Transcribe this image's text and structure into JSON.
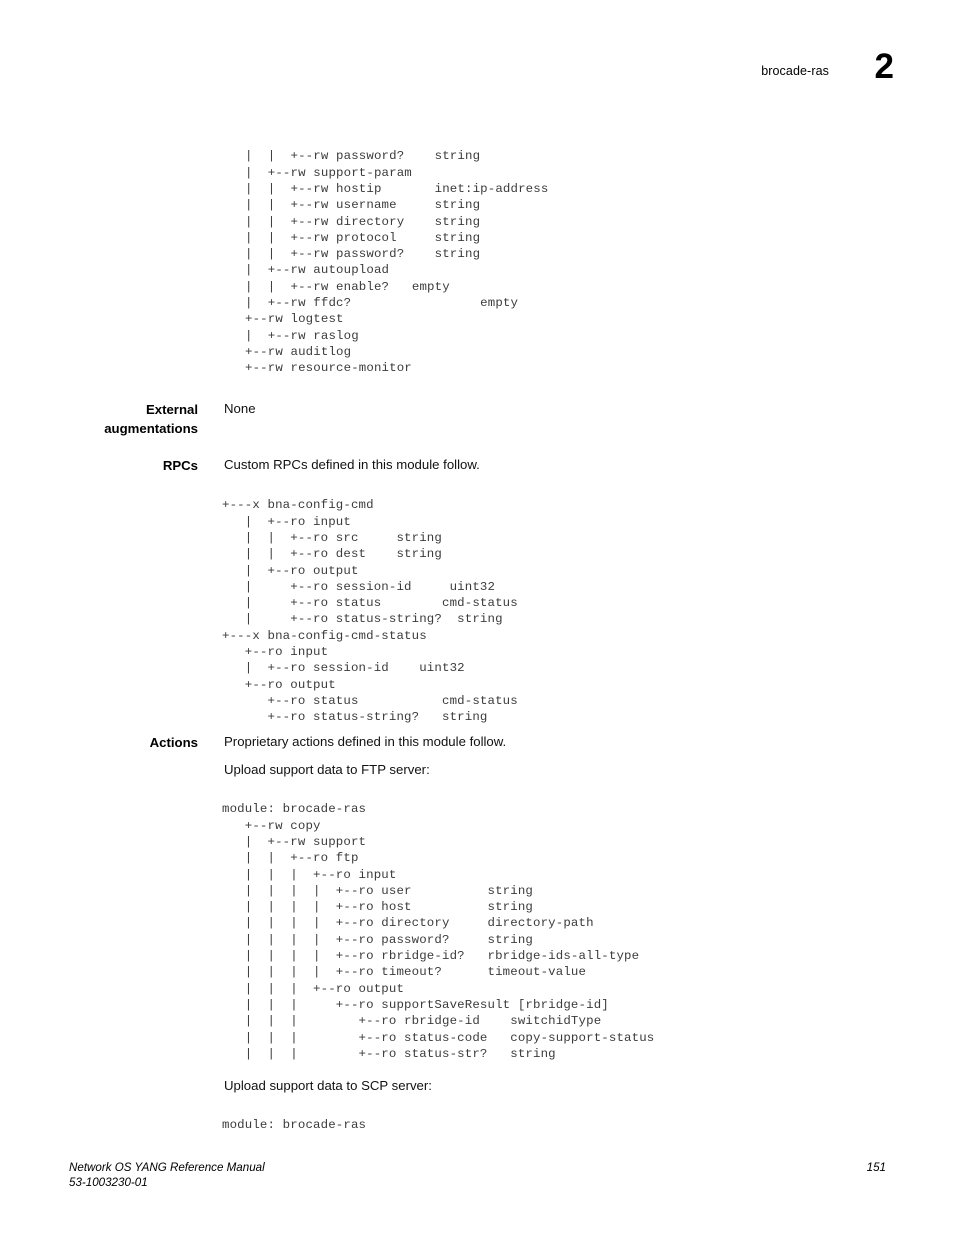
{
  "header": {
    "module_name": "brocade-ras",
    "chapter_number": "2"
  },
  "sections": {
    "external_augmentations": {
      "label": "External\naugmentations",
      "text": "None"
    },
    "rpcs": {
      "label": "RPCs",
      "text": "Custom RPCs defined in this module follow.",
      "code": "+---x bna-config-cmd\n   |  +--ro input\n   |  |  +--ro src     string\n   |  |  +--ro dest    string\n   |  +--ro output\n   |     +--ro session-id     uint32\n   |     +--ro status        cmd-status\n   |     +--ro status-string?  string\n+---x bna-config-cmd-status\n   +--ro input\n   |  +--ro session-id    uint32\n   +--ro output\n      +--ro status           cmd-status\n      +--ro status-string?   string"
    },
    "actions": {
      "label": "Actions",
      "text": "Proprietary actions defined in this module follow.",
      "ftp_intro": "Upload support data to FTP server:",
      "ftp_code": "module: brocade-ras\n   +--rw copy\n   |  +--rw support\n   |  |  +--ro ftp\n   |  |  |  +--ro input\n   |  |  |  |  +--ro user          string\n   |  |  |  |  +--ro host          string\n   |  |  |  |  +--ro directory     directory-path\n   |  |  |  |  +--ro password?     string\n   |  |  |  |  +--ro rbridge-id?   rbridge-ids-all-type\n   |  |  |  |  +--ro timeout?      timeout-value\n   |  |  |  +--ro output\n   |  |  |     +--ro supportSaveResult [rbridge-id]\n   |  |  |        +--ro rbridge-id    switchidType\n   |  |  |        +--ro status-code   copy-support-status\n   |  |  |        +--ro status-str?   string",
      "scp_intro": "Upload support data to SCP server:",
      "scp_code": "module: brocade-ras"
    }
  },
  "top_tree": {
    "code": "|  |  +--rw password?    string\n|  +--rw support-param\n|  |  +--rw hostip       inet:ip-address\n|  |  +--rw username     string\n|  |  +--rw directory    string\n|  |  +--rw protocol     string\n|  |  +--rw password?    string\n|  +--rw autoupload\n|  |  +--rw enable?   empty\n|  +--rw ffdc?                 empty\n+--rw logtest\n|  +--rw raslog\n+--rw auditlog\n+--rw resource-monitor"
  },
  "footer": {
    "manual_title": "Network OS YANG Reference Manual\n53-1003230-01",
    "page_number": "151"
  }
}
